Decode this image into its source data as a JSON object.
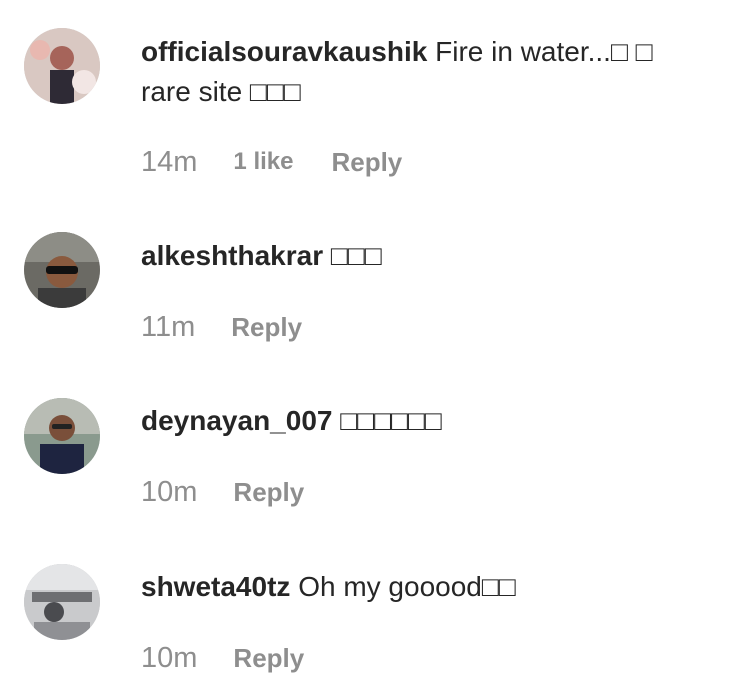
{
  "comments": [
    {
      "username": "officialsouravkaushik",
      "text": "Fire in water...□ □ rare site □□□",
      "time": "14m",
      "likes": "1 like",
      "reply": "Reply",
      "avatar_icon": "avatar-photo"
    },
    {
      "username": "alkeshthakrar",
      "text": "□□□",
      "time": "11m",
      "likes": null,
      "reply": "Reply",
      "avatar_icon": "avatar-photo"
    },
    {
      "username": "deynayan_007",
      "text": "□□□□□□",
      "time": "10m",
      "likes": null,
      "reply": "Reply",
      "avatar_icon": "avatar-photo"
    },
    {
      "username": "shweta40tz",
      "text": "Oh my gooood□□",
      "time": "10m",
      "likes": null,
      "reply": "Reply",
      "avatar_icon": "avatar-photo"
    }
  ],
  "colors": {
    "text": "#262626",
    "meta": "#8e8e8e",
    "background": "#ffffff"
  }
}
